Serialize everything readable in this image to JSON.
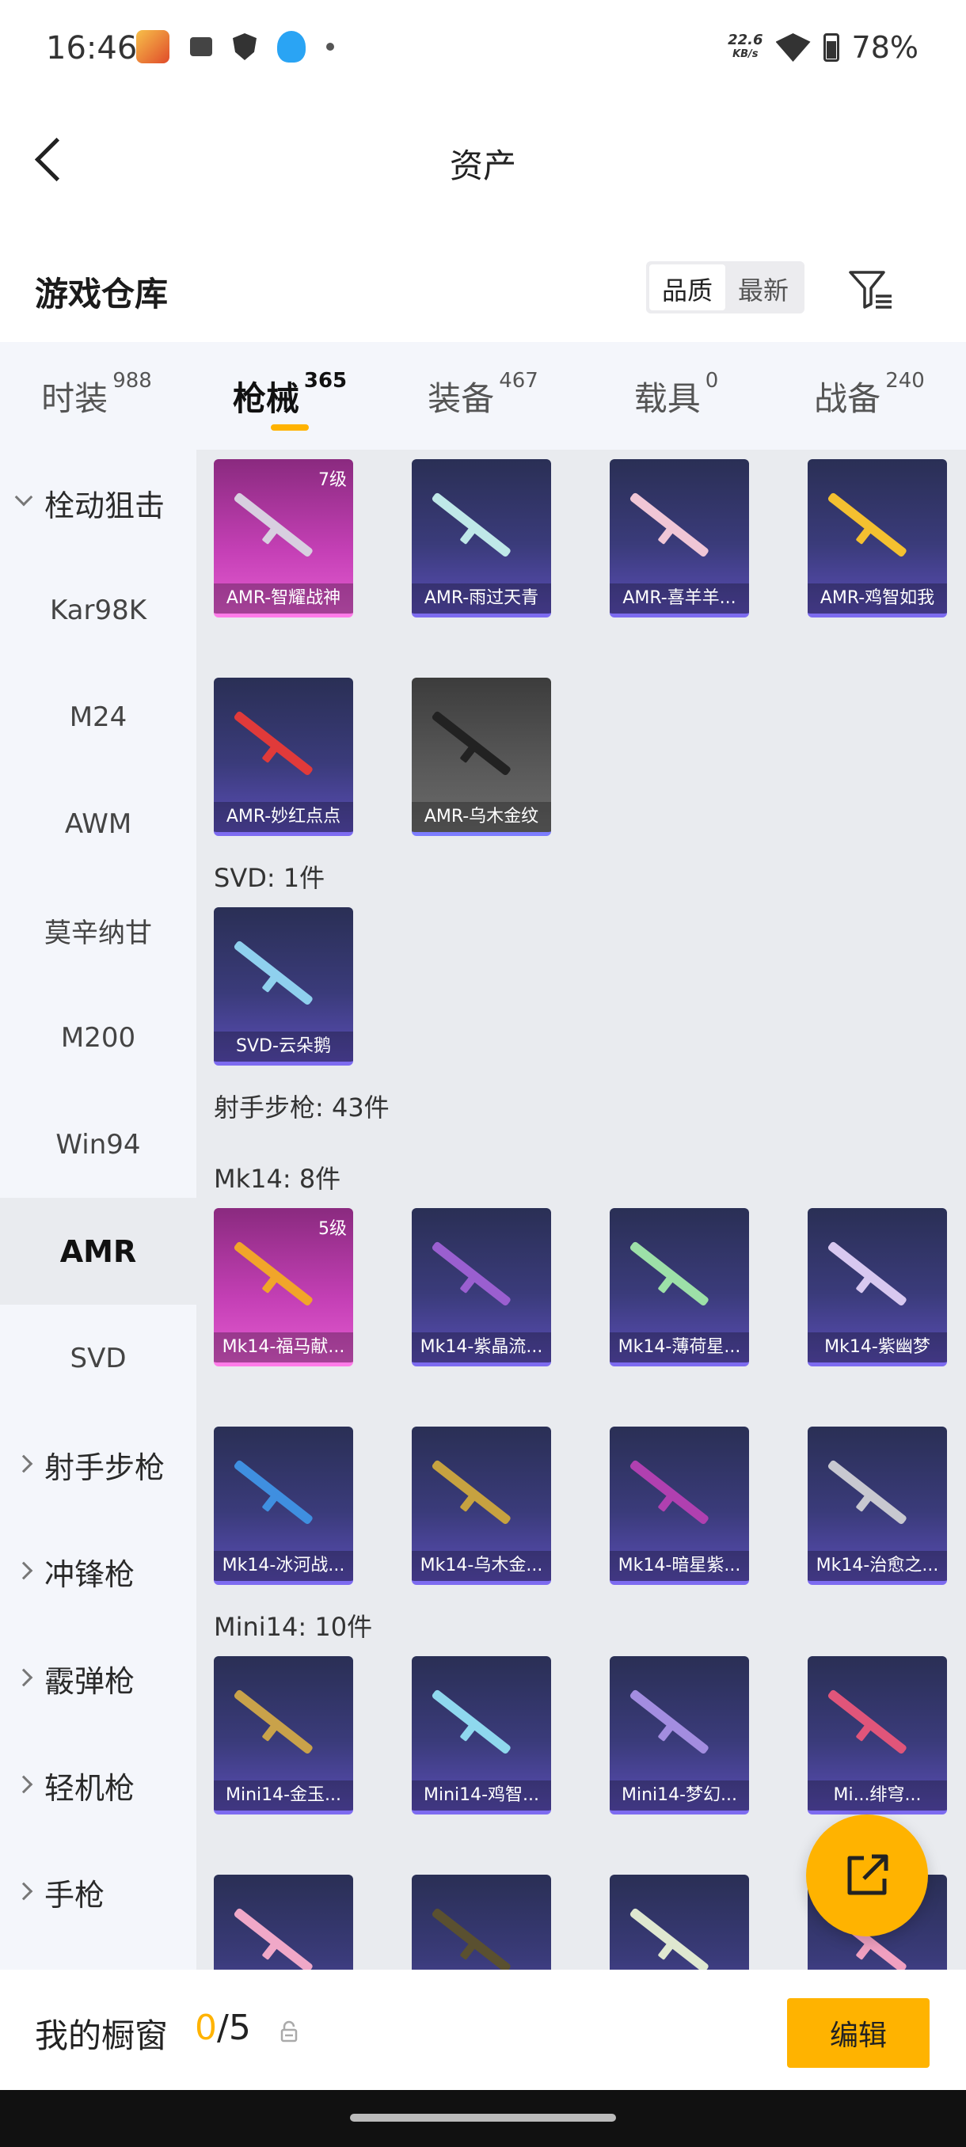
{
  "status_bar": {
    "time": "16:46",
    "net_speed_value": "22.6",
    "net_speed_unit": "KB/s",
    "battery": "78%"
  },
  "header": {
    "title": "资产"
  },
  "subheader": {
    "title": "游戏仓库",
    "sort_quality": "品质",
    "sort_newest": "最新"
  },
  "tabs": [
    {
      "label": "时装",
      "count": "988"
    },
    {
      "label": "枪械",
      "count": "365"
    },
    {
      "label": "装备",
      "count": "467"
    },
    {
      "label": "载具",
      "count": "0"
    },
    {
      "label": "战备",
      "count": "240"
    }
  ],
  "sidebar": [
    {
      "label": "栓动狙击"
    },
    {
      "label": "Kar98K"
    },
    {
      "label": "M24"
    },
    {
      "label": "AWM"
    },
    {
      "label": "莫辛纳甘"
    },
    {
      "label": "M200"
    },
    {
      "label": "Win94"
    },
    {
      "label": "AMR"
    },
    {
      "label": "SVD"
    },
    {
      "label": "射手步枪"
    },
    {
      "label": "冲锋枪"
    },
    {
      "label": "霰弹枪"
    },
    {
      "label": "轻机枪"
    },
    {
      "label": "手枪"
    }
  ],
  "content": {
    "amr_items": [
      {
        "name": "AMR-智耀战神",
        "level": "7级"
      },
      {
        "name": "AMR-雨过天青"
      },
      {
        "name": "AMR-喜羊羊..."
      },
      {
        "name": "AMR-鸡智如我"
      },
      {
        "name": "AMR-妙红点点"
      },
      {
        "name": "AMR-乌木金纹"
      }
    ],
    "svd_header": "SVD: 1件",
    "svd_items": [
      {
        "name": "SVD-云朵鹅"
      }
    ],
    "marksman_header": "射手步枪: 43件",
    "mk14_header": "Mk14: 8件",
    "mk14_items": [
      {
        "name": "Mk14-福马献...",
        "level": "5级"
      },
      {
        "name": "Mk14-紫晶流..."
      },
      {
        "name": "Mk14-薄荷星..."
      },
      {
        "name": "Mk14-紫幽梦"
      },
      {
        "name": "Mk14-冰河战..."
      },
      {
        "name": "Mk14-乌木金..."
      },
      {
        "name": "Mk14-暗星紫..."
      },
      {
        "name": "Mk14-治愈之..."
      }
    ],
    "mini14_header": "Mini14: 10件",
    "mini14_items": [
      {
        "name": "Mini14-金玉..."
      },
      {
        "name": "Mini14-鸡智..."
      },
      {
        "name": "Mini14-梦幻..."
      },
      {
        "name": "Mi...绯穹..."
      }
    ]
  },
  "bottom_bar": {
    "label": "我的橱窗",
    "current": "0",
    "total": "/5",
    "edit_label": "编辑"
  },
  "colors": {
    "accent": "#ffb300",
    "card_purple": "#3a3b7a",
    "card_pink": "#c540b6"
  }
}
